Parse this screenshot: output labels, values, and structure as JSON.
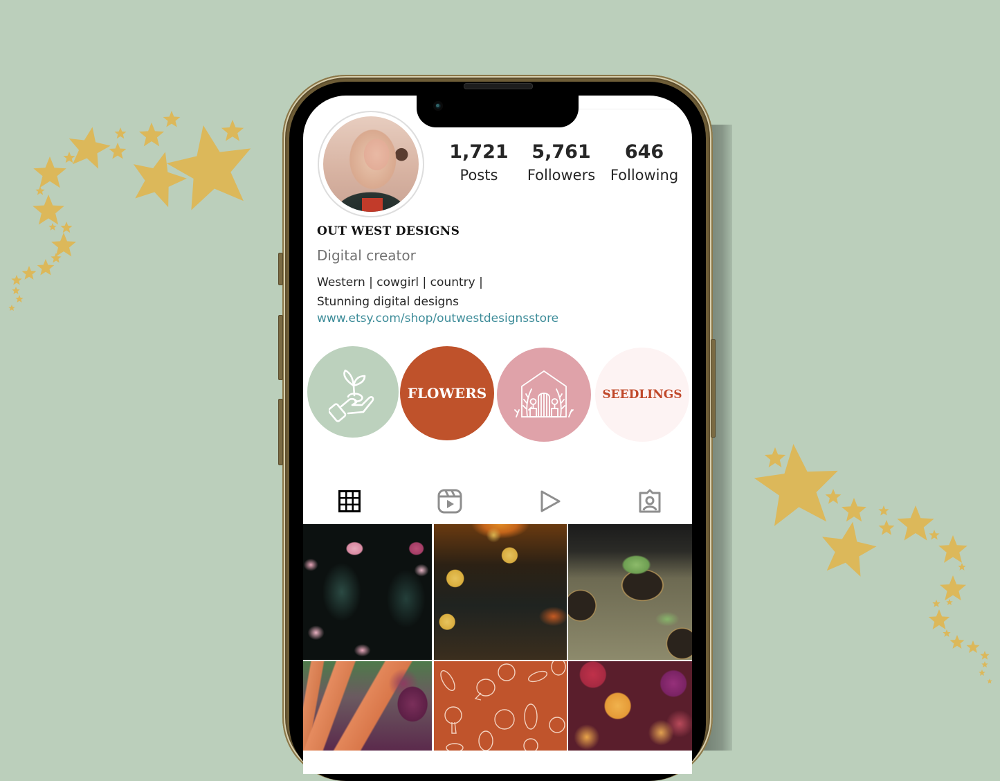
{
  "profile": {
    "username": "OUT WEST DESIGNS",
    "category": "Digital creator",
    "bio_lines": [
      "Western | cowgirl | country |",
      "Stunning digital designs"
    ],
    "link": "www.etsy.com/shop/outwestdesignsstore",
    "avatar_alt": "profile-photo"
  },
  "stats": [
    {
      "value": "1,721",
      "label": "Posts"
    },
    {
      "value": "5,761",
      "label": "Followers"
    },
    {
      "value": "646",
      "label": "Following"
    }
  ],
  "highlights": [
    {
      "label": "",
      "icon": "hand-sprout-icon",
      "bg": "#bcd1bd",
      "fg": "#ffffff"
    },
    {
      "label": "FLOWERS",
      "icon": "",
      "bg": "#bf522b",
      "fg": "#ffffff"
    },
    {
      "label": "",
      "icon": "greenhouse-icon",
      "bg": "#dfa2a9",
      "fg": "#ffffff"
    },
    {
      "label": "SEEDLINGS",
      "icon": "",
      "bg": "#fdf3f3",
      "fg": "#c0482a"
    }
  ],
  "tabs": [
    {
      "name": "posts-grid",
      "icon": "grid-icon",
      "active": true
    },
    {
      "name": "reels",
      "icon": "reels-icon",
      "active": false
    },
    {
      "name": "videos",
      "icon": "play-icon",
      "active": false
    },
    {
      "name": "tagged",
      "icon": "tagged-user-icon",
      "active": false
    }
  ],
  "posts": [
    {
      "subject": "pink camellia flowers"
    },
    {
      "subject": "yellow daisies at sunset"
    },
    {
      "subject": "seedlings in peat pots"
    },
    {
      "subject": "carrots and beets"
    },
    {
      "subject": "vegetable outline pattern"
    },
    {
      "subject": "chrysanthemums"
    }
  ],
  "colors": {
    "background": "#bbcfbb",
    "gold": "#dcb85a",
    "link": "#3d8c99",
    "terracotta": "#bf522b"
  }
}
